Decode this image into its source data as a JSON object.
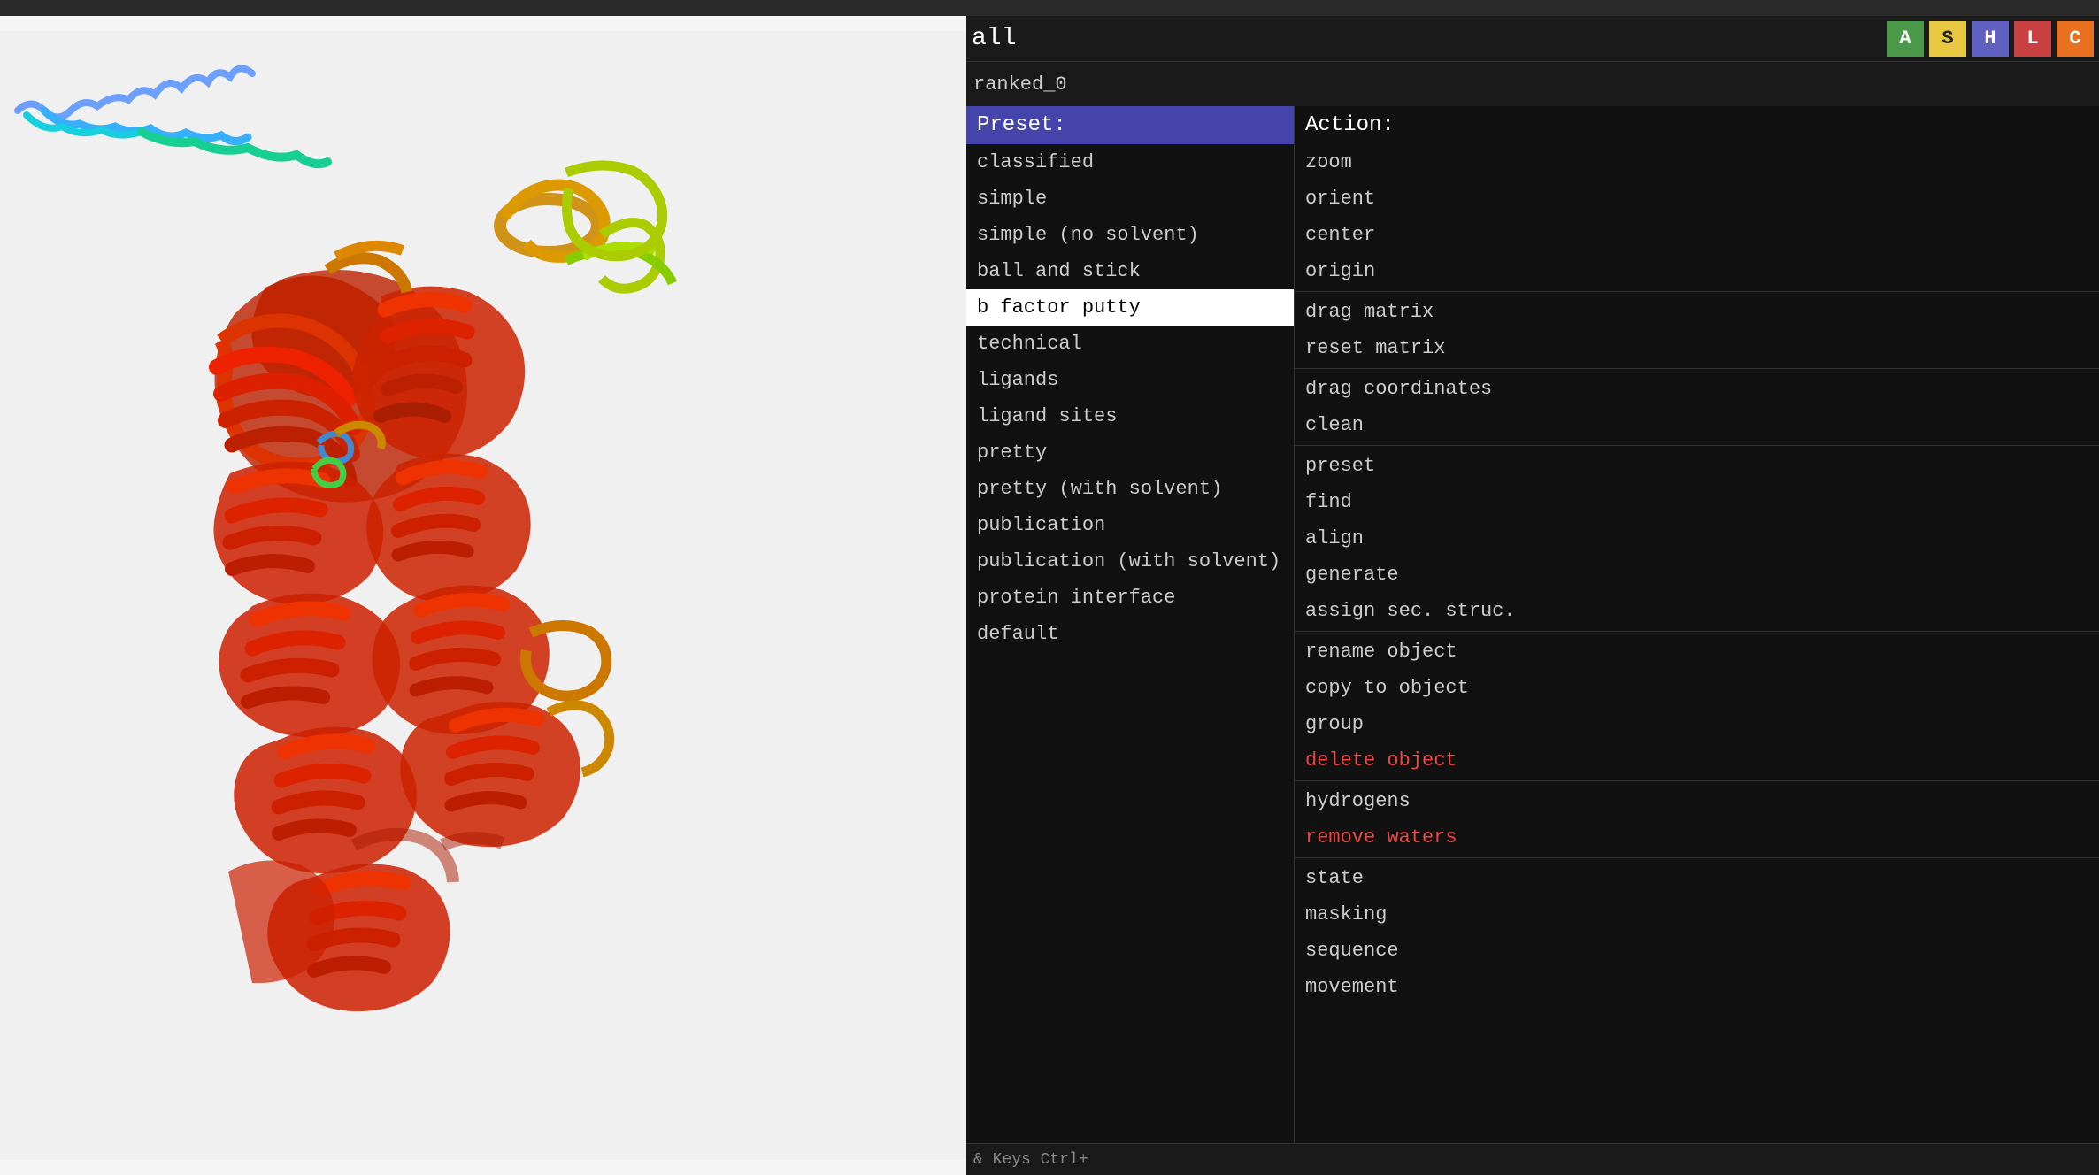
{
  "header": {
    "all_label": "all",
    "ranked_label": "ranked_0",
    "buttons": [
      {
        "id": "btn-a",
        "label": "A"
      },
      {
        "id": "btn-s",
        "label": "S"
      },
      {
        "id": "btn-h",
        "label": "H"
      },
      {
        "id": "btn-l",
        "label": "L"
      },
      {
        "id": "btn-c",
        "label": "C"
      }
    ]
  },
  "preset_panel": {
    "header": "Preset:",
    "items": [
      {
        "label": "classified",
        "highlighted": false
      },
      {
        "label": "simple",
        "highlighted": false
      },
      {
        "label": "simple (no solvent)",
        "highlighted": false
      },
      {
        "label": "ball and stick",
        "highlighted": false
      },
      {
        "label": "b factor putty",
        "highlighted": true
      },
      {
        "label": "technical",
        "highlighted": false
      },
      {
        "label": "ligands",
        "highlighted": false
      },
      {
        "label": "ligand sites",
        "highlighted": false
      },
      {
        "label": "pretty",
        "highlighted": false
      },
      {
        "label": "pretty (with solvent)",
        "highlighted": false
      },
      {
        "label": "publication",
        "highlighted": false
      },
      {
        "label": "publication (with solvent)",
        "highlighted": false
      },
      {
        "label": "protein interface",
        "highlighted": false
      },
      {
        "label": "default",
        "highlighted": false
      }
    ]
  },
  "action_panel": {
    "header": "Action:",
    "items": [
      {
        "label": "zoom",
        "type": "normal",
        "separator": false
      },
      {
        "label": "orient",
        "type": "normal",
        "separator": false
      },
      {
        "label": "center",
        "type": "normal",
        "separator": false
      },
      {
        "label": "origin",
        "type": "normal",
        "separator": false
      },
      {
        "label": "drag matrix",
        "type": "normal",
        "separator": true
      },
      {
        "label": "reset matrix",
        "type": "normal",
        "separator": false
      },
      {
        "label": "drag coordinates",
        "type": "normal",
        "separator": true
      },
      {
        "label": "clean",
        "type": "normal",
        "separator": false
      },
      {
        "label": "preset",
        "type": "normal",
        "separator": true
      },
      {
        "label": "find",
        "type": "normal",
        "separator": false
      },
      {
        "label": "align",
        "type": "normal",
        "separator": false
      },
      {
        "label": "generate",
        "type": "normal",
        "separator": false
      },
      {
        "label": "assign sec. struc.",
        "type": "normal",
        "separator": false
      },
      {
        "label": "rename object",
        "type": "normal",
        "separator": true
      },
      {
        "label": "copy to object",
        "type": "normal",
        "separator": false
      },
      {
        "label": "group",
        "type": "normal",
        "separator": false
      },
      {
        "label": "delete object",
        "type": "red",
        "separator": false
      },
      {
        "label": "hydrogens",
        "type": "normal",
        "separator": true
      },
      {
        "label": "remove waters",
        "type": "red",
        "separator": false
      },
      {
        "label": "state",
        "type": "normal",
        "separator": true
      },
      {
        "label": "masking",
        "type": "normal",
        "separator": false
      },
      {
        "label": "sequence",
        "type": "normal",
        "separator": false
      },
      {
        "label": "movement",
        "type": "normal",
        "separator": false
      }
    ]
  },
  "bottom": {
    "text": "& Keys   Ctrl+"
  }
}
